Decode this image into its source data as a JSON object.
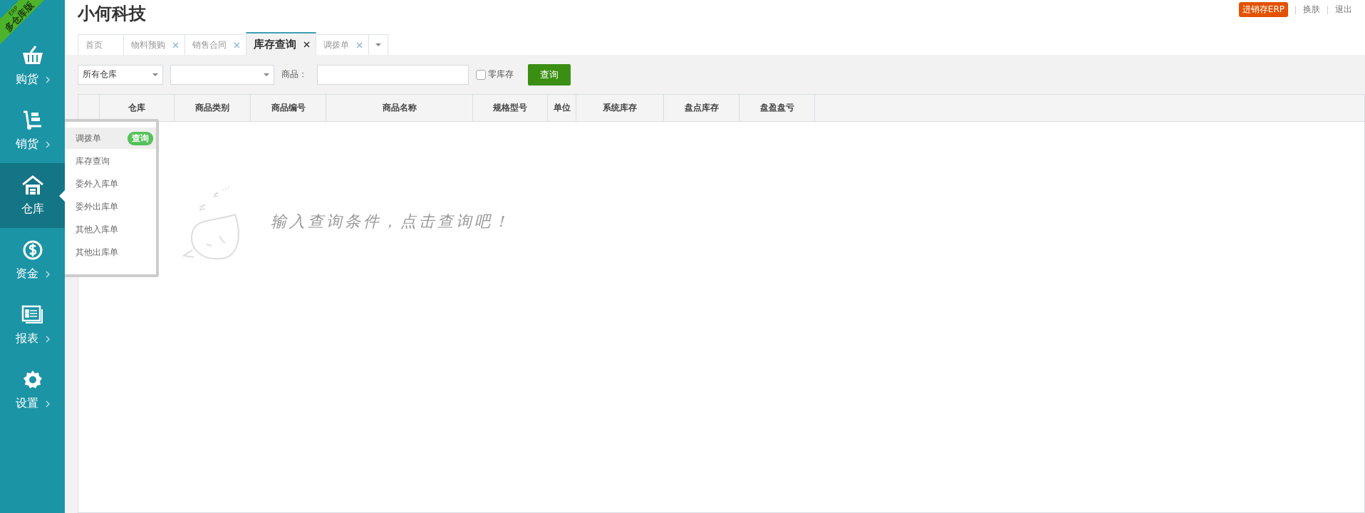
{
  "edition_ribbon": {
    "brand": "ERP",
    "label": "多仓库版"
  },
  "sidebar": {
    "items": [
      {
        "label": "购货",
        "selected": false
      },
      {
        "label": "销货",
        "selected": false
      },
      {
        "label": "仓库",
        "selected": true
      },
      {
        "label": "资金",
        "selected": false
      },
      {
        "label": "报表",
        "selected": false
      },
      {
        "label": "设置",
        "selected": false
      }
    ]
  },
  "flyout_menu": {
    "items": [
      {
        "label": "调拨单",
        "selected": true,
        "badge": "查询"
      },
      {
        "label": "库存查询",
        "selected": false
      },
      {
        "label": "委外入库单",
        "selected": false
      },
      {
        "label": "委外出库单",
        "selected": false
      },
      {
        "label": "其他入库单",
        "selected": false
      },
      {
        "label": "其他出库单",
        "selected": false
      }
    ]
  },
  "header": {
    "title": "小何科技",
    "links": [
      {
        "label": "进销存ERP",
        "kind": "badge"
      },
      {
        "label": "换肤",
        "kind": "link"
      },
      {
        "label": "退出",
        "kind": "link"
      }
    ]
  },
  "tabs": [
    {
      "label": "首页",
      "selected": false,
      "closable": false
    },
    {
      "label": "物料预购",
      "selected": false,
      "closable": true
    },
    {
      "label": "销售合同",
      "selected": false,
      "closable": true
    },
    {
      "label": "库存查询",
      "selected": true,
      "closable": true
    },
    {
      "label": "调拨单",
      "selected": false,
      "closable": true
    }
  ],
  "toolbar": {
    "warehouse_select": "所有仓库",
    "product_label": "商品：",
    "zero_stock": {
      "label": "零库存",
      "checked": false
    },
    "query_button": "查询"
  },
  "table": {
    "columns": [
      "仓库",
      "商品类别",
      "商品编号",
      "商品名称",
      "规格型号",
      "单位",
      "系统库存",
      "盘点库存",
      "盘盈盘亏"
    ]
  },
  "empty_state": {
    "message": "输入查询条件，点击查询吧！"
  }
}
